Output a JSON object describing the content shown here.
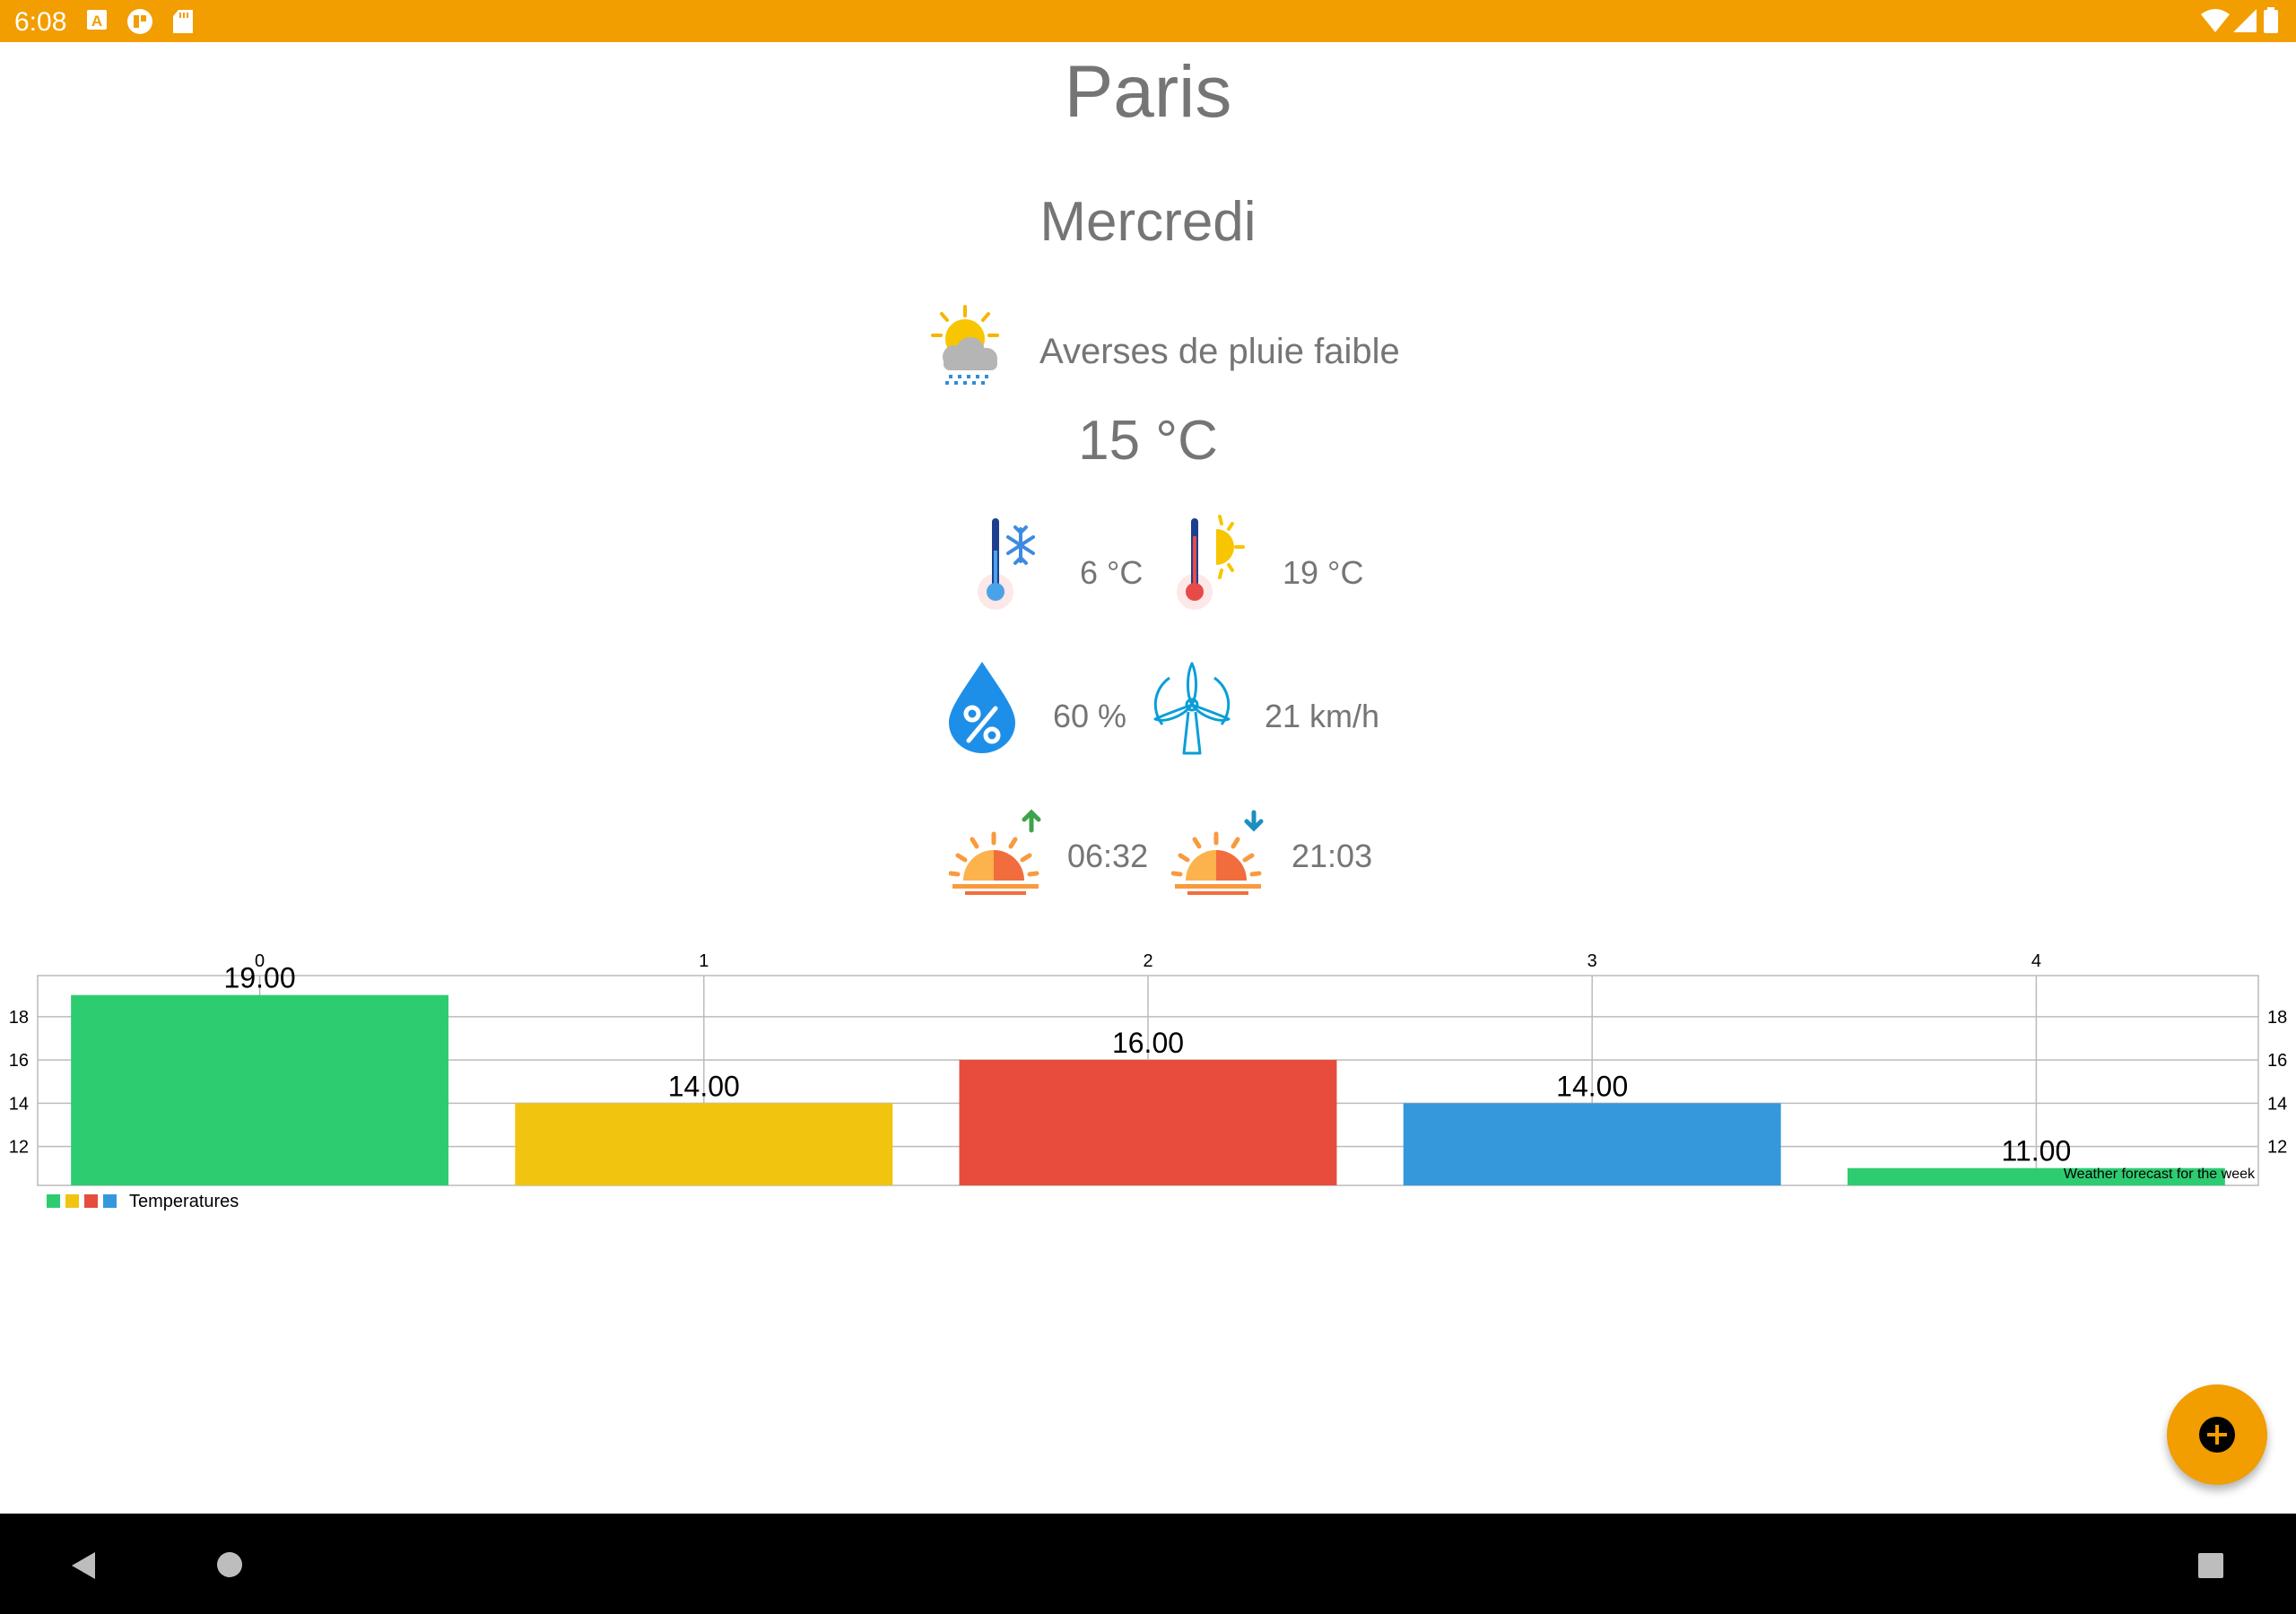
{
  "status_bar": {
    "time": "6:08",
    "icons": [
      "notification-a-icon",
      "app-icon",
      "sd-card-icon",
      "wifi-icon",
      "signal-icon",
      "battery-icon"
    ],
    "color": "#f29d00"
  },
  "weather": {
    "city": "Paris",
    "day": "Mercredi",
    "condition": "Averses de pluie faible",
    "temperature": "15 °C",
    "min_temp": "6 °C",
    "max_temp": "19 °C",
    "humidity": "60 %",
    "wind": "21 km/h",
    "sunrise": "06:32",
    "sunset": "21:03"
  },
  "chart_data": {
    "type": "bar",
    "categories": [
      "0",
      "1",
      "2",
      "3",
      "4"
    ],
    "values": [
      19,
      14,
      16,
      14,
      11
    ],
    "value_labels": [
      "19.00",
      "14.00",
      "16.00",
      "14.00",
      "11.00"
    ],
    "colors": [
      "#2ecc71",
      "#f1c40f",
      "#e74c3c",
      "#3498db",
      "#2ecc71"
    ],
    "y_ticks": [
      12,
      14,
      16,
      18
    ],
    "ylim": [
      10.2,
      19.9
    ],
    "grid": true,
    "legend": {
      "position": "bottom-left",
      "label": "Temperatures",
      "colors": [
        "#2ecc71",
        "#f1c40f",
        "#e74c3c",
        "#3498db"
      ]
    },
    "description": "Weather forecast for the week"
  },
  "fab": {
    "icon": "add-icon",
    "color": "#f29d00"
  },
  "nav_bar": {
    "icons": [
      "back-icon",
      "home-icon",
      "recents-icon"
    ]
  }
}
